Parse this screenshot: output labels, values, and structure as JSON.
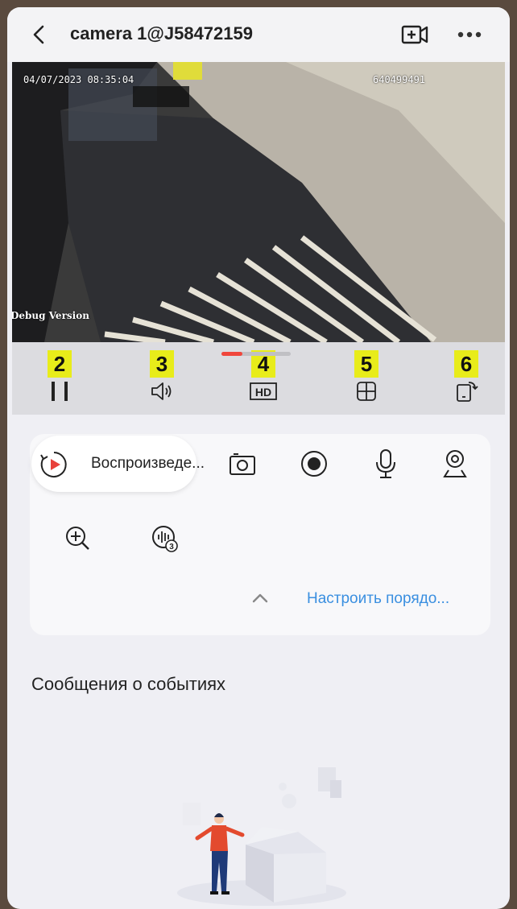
{
  "header": {
    "title": "camera 1@J58472159",
    "back_icon": "chevron-left-icon",
    "record_icon": "video-add-icon",
    "more_icon": "more-dots-icon"
  },
  "video": {
    "timestamp": "04/07/2023 08:35:04",
    "device_id": "640499491",
    "debug_label": "Debug Version"
  },
  "controls": [
    {
      "badge": "2",
      "icon": "pause-icon"
    },
    {
      "badge": "3",
      "icon": "speaker-icon"
    },
    {
      "badge": "4",
      "icon": "hd-icon"
    },
    {
      "badge": "5",
      "icon": "grid-icon"
    },
    {
      "badge": "6",
      "icon": "rotate-screen-icon"
    }
  ],
  "progress": 0.3,
  "tools": {
    "playback_label": "Воспроизведе...",
    "icons": [
      "playback-icon",
      "snapshot-icon",
      "record-icon",
      "microphone-icon",
      "ptz-icon",
      "zoom-in-icon",
      "audio-3-icon",
      "chevron-up-icon"
    ],
    "customize_label": "Настроить порядо..."
  },
  "events": {
    "title": "Сообщения о событиях"
  },
  "colors": {
    "accent_blue": "#3a8fe0",
    "badge_yellow": "#e8ec1a",
    "progress_red": "#f0463c"
  }
}
